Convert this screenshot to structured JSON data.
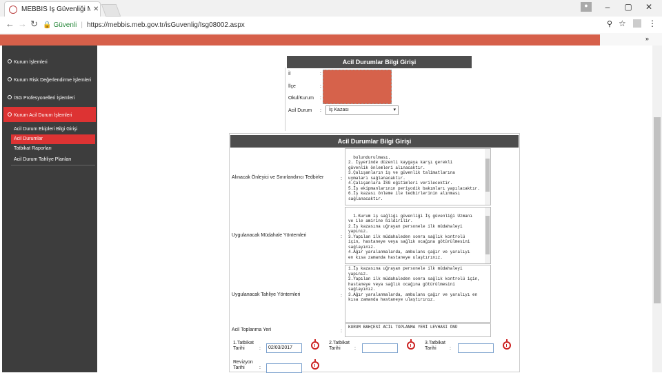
{
  "browser": {
    "tab_title": "MEBBIS İş Güvenliği Mod",
    "secure_label": "Güvenli",
    "url": "https://mebbis.meb.gov.tr/isGuvenlig/Isg08002.aspx"
  },
  "sidebar": {
    "items": [
      {
        "label": "Kurum İşlemleri"
      },
      {
        "label": "Kurum Risk Değerlendirme İşlemleri"
      },
      {
        "label": "İSG Profesyonelleri İşlemleri"
      },
      {
        "label": "Kurum Acil Durum İşlemleri"
      }
    ],
    "subitems": [
      {
        "label": "Acil Durum Ekipleri Bilgi Girişi"
      },
      {
        "label": "Acil Durumlar"
      },
      {
        "label": "Tatbikat Raporları"
      },
      {
        "label": "Acil Durum Tahliye Planları"
      }
    ]
  },
  "panel1": {
    "title": "Acil Durumlar Bilgi Girişi",
    "fields": [
      {
        "label": "İl"
      },
      {
        "label": "İlçe"
      },
      {
        "label": "Okul/Kurum"
      },
      {
        "label": "Acil Durum"
      }
    ],
    "acil_durum_value": "İş Kazası"
  },
  "panel2": {
    "title": "Acil Durumlar Bilgi Girişi",
    "onleyici_label": "Alınacak Önleyici ve Sınırlandırıcı Tedbirler",
    "onleyici_text": "bulundurulması.\n2. İşyerinde düzenli kaygaya karşı gerekli\ngüvenlik önlemleri alınacaktır.\n3.Çalışanların iş ve güvenlik talimatlarına\nuymaları sağlanacaktır.\n4.Çalışanlara İSG eğitimleri verilecektir.\n5.İş ekipmanlarının periyodik bakımları yapılacaktır.\n6.İş kazası önleme ile tedbirlerinin alınması\nsağlanacaktır.",
    "mudahale_label": "Uygulanacak Müdahale Yöntemleri",
    "mudahale_text": "1.Kurum iş sağlığı güvenliği İş güvenliği Uzmanı\nve ile amirine bildirilir.\n2.İş kazasına uğrayan personele ilk müdahaleyi\nyapınız.\n3.Yapılan ilk müdahaleden sonra sağlık kontrolü\niçin, hastaneye veya sağlık ocağına götürülmesini\nsağlayınız.\n4.Ağır yaralanmalarda, ambulans çağır ve yaralıyı\nen kısa zamanda hastaneye ulaştırınız.",
    "tahliye_label": "Uygulanacak Tahliye Yöntemleri",
    "tahliye_text": "1.İş kazasına uğrayan personele ilk müdahaleyi\nyapınız.\n2.Yapılan ilk müdahaleden sonra sağlık kontrolü için,\nhastaneye veya sağlık ocağına götürülmesini\nsağlayınız.\n3.Ağır yaralanmalarda, ambulans çağır ve yaralıyı en\nkısa zamanda hastaneye ulaştırınız.",
    "toplanma_label": "Acil Toplanma Yeri",
    "toplanma_text": "KURUM BAHÇESİ ACİL TOPLANMA YERİ LEVHASI ÖNÜ",
    "tatbikat1_label": "1.Tatbikat Tarihi",
    "tatbikat1_value": "02/03/2017",
    "tatbikat2_label": "2.Tatbikat Tarihi",
    "tatbikat2_value": "",
    "tatbikat3_label": "3.Tatbikat Tarihi",
    "tatbikat3_value": "",
    "revizyon_label": "Revizyon Tarihi",
    "revizyon_value": ""
  },
  "colors": {
    "accent": "#d6604a",
    "active": "#dd3333",
    "sidebar": "#3d3d3d",
    "header": "#4d4d4d"
  }
}
